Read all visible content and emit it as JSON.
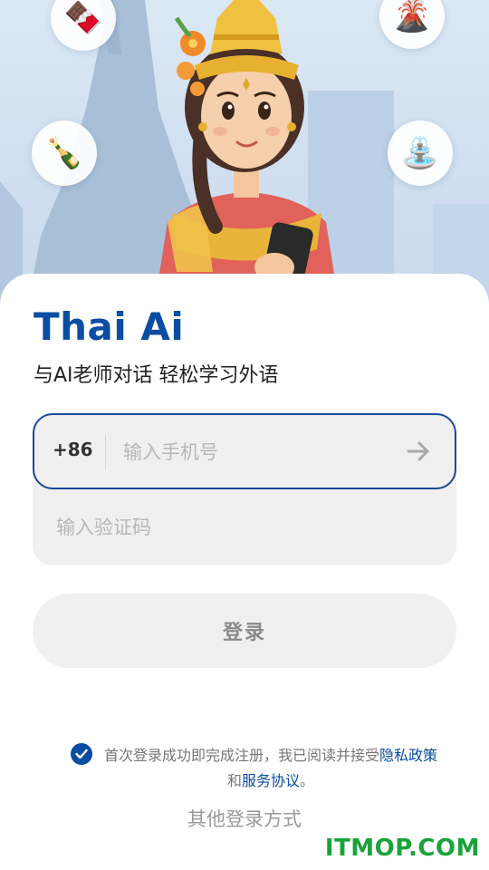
{
  "hero": {
    "bubbles": [
      {
        "icon": "chocolate-icon",
        "glyph": "🍫"
      },
      {
        "icon": "volcano-icon",
        "glyph": "🌋"
      },
      {
        "icon": "champagne-icon",
        "glyph": "🍾"
      },
      {
        "icon": "fountain-icon",
        "glyph": "⛲"
      }
    ]
  },
  "app": {
    "title": "Thai Ai",
    "subtitle": "与AI老师对话 轻松学习外语"
  },
  "form": {
    "country_code": "+86",
    "phone_placeholder": "输入手机号",
    "code_placeholder": "输入验证码",
    "login_label": "登录"
  },
  "agreement": {
    "checked": true,
    "prefix": "首次登录成功即完成注册，我已阅读并接受",
    "privacy_link": "隐私政策",
    "connector": "和",
    "terms_link": "服务协议",
    "suffix": "。"
  },
  "other_login": "其他登录方式",
  "watermark": "ITMOP.COM",
  "colors": {
    "brand": "#0a4da2",
    "input_bg": "#f0f0f0",
    "watermark": "#1aa23a"
  }
}
